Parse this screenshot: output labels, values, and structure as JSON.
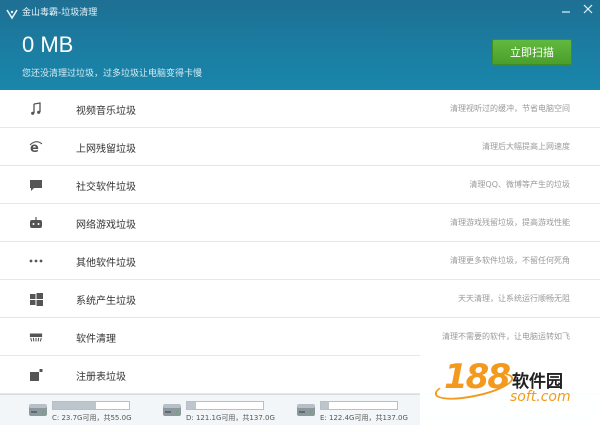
{
  "window": {
    "title": "金山毒霸-垃圾清理"
  },
  "header": {
    "size": "0 MB",
    "subtitle": "您还没清理过垃圾，过多垃圾让电脑变得卡慢",
    "scan_button": "立即扫描"
  },
  "items": [
    {
      "icon": "music-note-icon",
      "label": "视频音乐垃圾",
      "desc": "清理视听过的缓冲，节省电脑空间"
    },
    {
      "icon": "ie-browser-icon",
      "label": "上网残留垃圾",
      "desc": "清理后大幅提高上网速度"
    },
    {
      "icon": "chat-bubble-icon",
      "label": "社交软件垃圾",
      "desc": "清理QQ、微博等产生的垃圾"
    },
    {
      "icon": "game-controller-icon",
      "label": "网络游戏垃圾",
      "desc": "清理游戏残留垃圾，提高游戏性能"
    },
    {
      "icon": "more-dots-icon",
      "label": "其他软件垃圾",
      "desc": "清理更多软件垃圾，不留任何死角"
    },
    {
      "icon": "windows-logo-icon",
      "label": "系统产生垃圾",
      "desc": "天天清理，让系统运行顺畅无阻"
    },
    {
      "icon": "software-clean-icon",
      "label": "软件清理",
      "desc": "清理不需要的软件，让电脑运转如飞"
    },
    {
      "icon": "registry-icon",
      "label": "注册表垃圾",
      "desc": ""
    }
  ],
  "disks": [
    {
      "info": "C: 23.7G可用，共55.0G",
      "used_fraction": 0.57
    },
    {
      "info": "D: 121.1G可用，共137.0G",
      "used_fraction": 0.12
    },
    {
      "info": "E: 122.4G可用，共137.0G",
      "used_fraction": 0.11
    }
  ],
  "watermark": {
    "number": "188",
    "name": "软件园",
    "site": "soft.com"
  },
  "colors": {
    "header": "#1b7da2",
    "scan_button": "#54a832",
    "watermark": "#f39a1e"
  }
}
